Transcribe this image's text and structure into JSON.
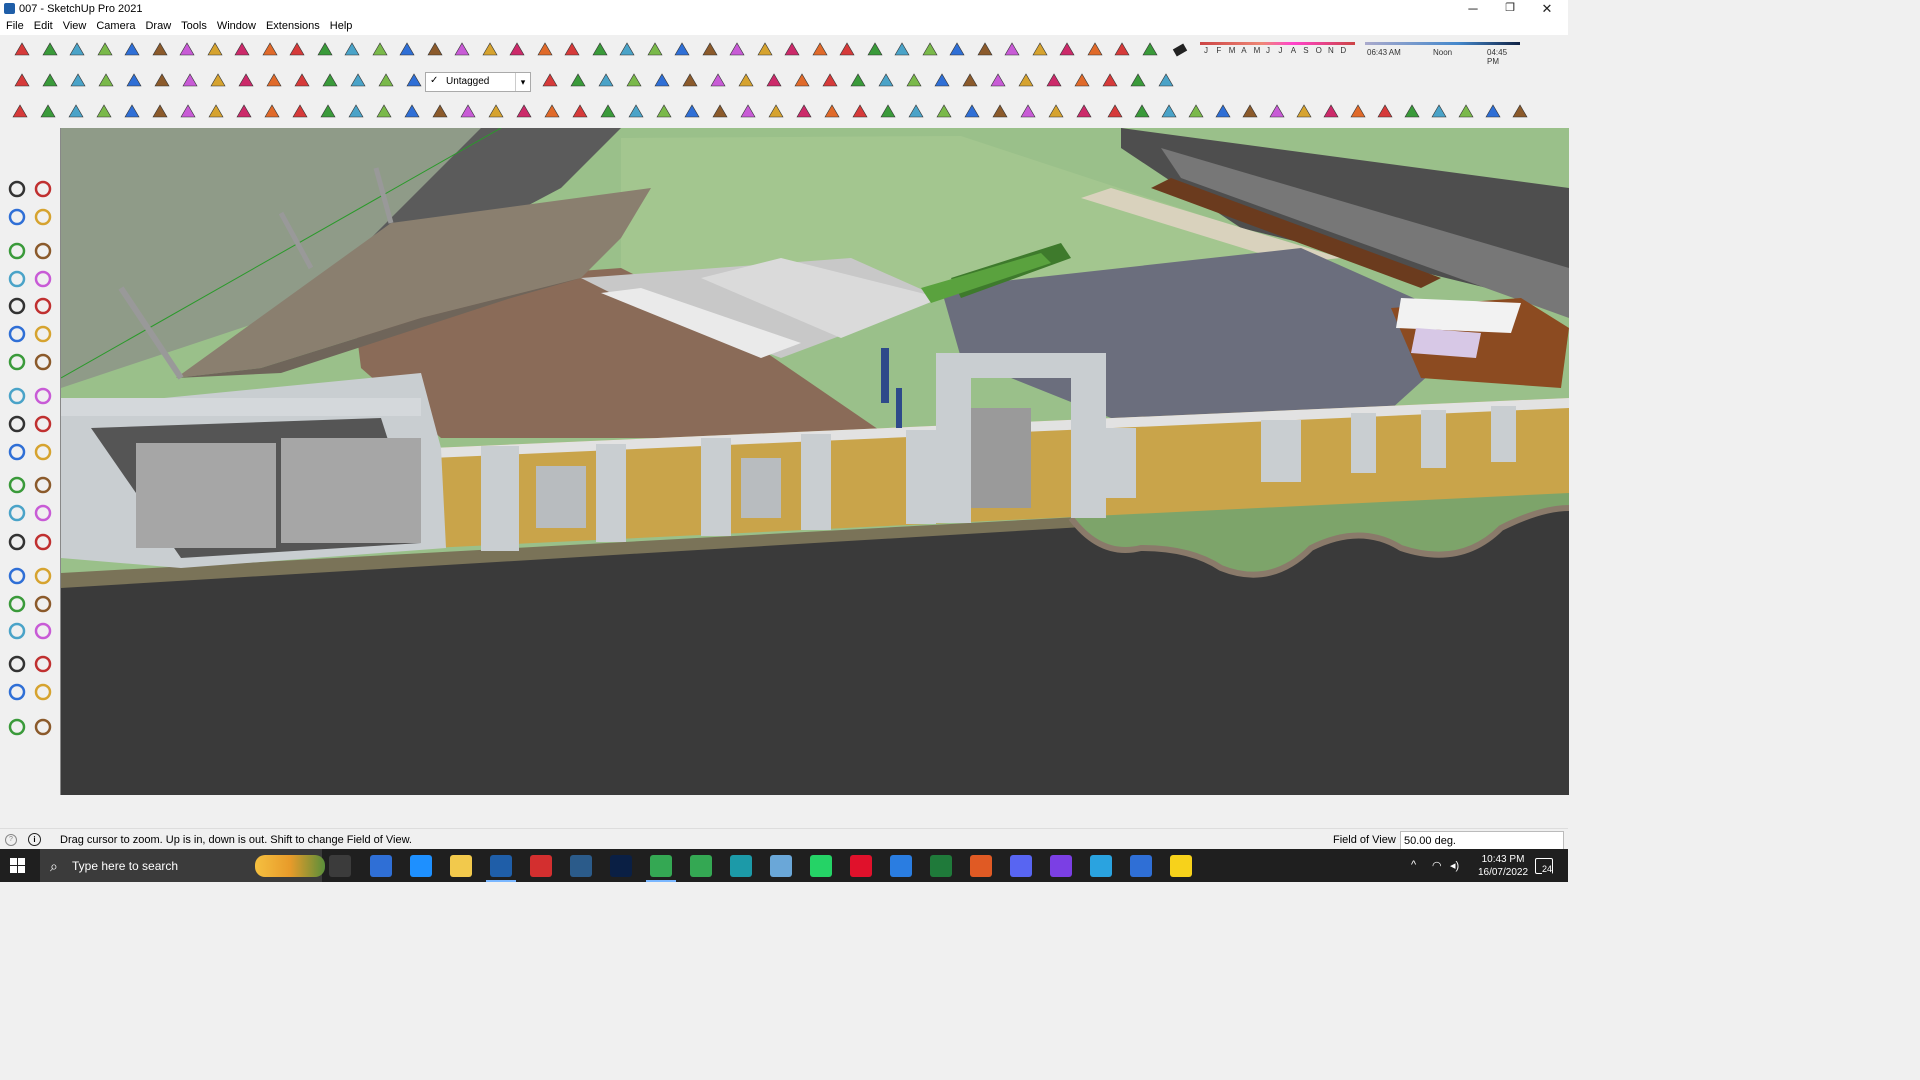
{
  "window": {
    "title": "007 - SketchUp Pro 2021",
    "min": "─",
    "restore": "❐",
    "close": "✕"
  },
  "menu": [
    "File",
    "Edit",
    "View",
    "Camera",
    "Draw",
    "Tools",
    "Window",
    "Extensions",
    "Help"
  ],
  "shadow": {
    "months": [
      "J",
      "F",
      "M",
      "A",
      "M",
      "J",
      "J",
      "A",
      "S",
      "O",
      "N",
      "D"
    ],
    "time_start": "06:43 AM",
    "time_mid": "Noon",
    "time_end": "04:45 PM"
  },
  "tag_dropdown": {
    "value": "Untagged",
    "check": "✓",
    "arrow": "▾"
  },
  "statusbar": {
    "message": "Drag cursor to zoom.  Up is in, down is out. Shift to change Field of View.",
    "fov_label": "Field of View",
    "fov_value": "50.00 deg."
  },
  "taskbar": {
    "search_placeholder": "Type here to search",
    "time": "10:43 PM",
    "date": "16/07/2022",
    "notif_count": "24"
  },
  "colors": {
    "accent": "#1f5ea8",
    "lawn": "#9ac08a",
    "road": "#3a3a3a",
    "wall_wood": "#c9a44a",
    "canopy": "#8a7f6f"
  }
}
